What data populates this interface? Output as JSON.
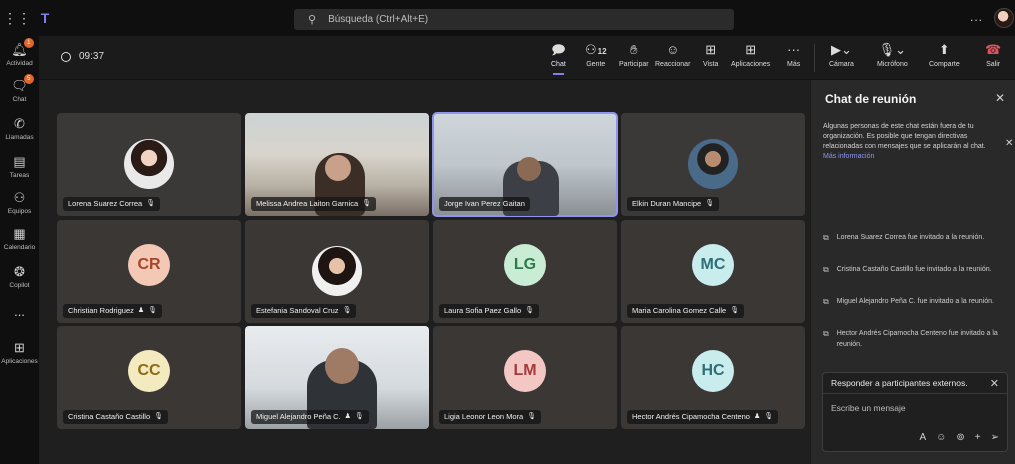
{
  "titlebar": {
    "grid_icon": "apps-grid-icon",
    "search_placeholder": "Búsqueda (Ctrl+Alt+E)",
    "more": "..."
  },
  "rail": {
    "items": [
      {
        "label": "Actividad",
        "badge": "1"
      },
      {
        "label": "Chat",
        "badge": "5"
      },
      {
        "label": "Llamadas"
      },
      {
        "label": "Tareas"
      },
      {
        "label": "Equipos"
      },
      {
        "label": "Calendario"
      },
      {
        "label": "Copilot"
      },
      {
        "label": "..."
      },
      {
        "label": "Aplicaciones"
      }
    ]
  },
  "toolbar": {
    "timer": "09:37",
    "chat": "Chat",
    "people": "Gente",
    "people_count": "12",
    "raise": "Participar",
    "react": "Reaccionar",
    "view": "Vista",
    "apps": "Aplicaciones",
    "more": "Más",
    "camera": "Cámara",
    "mic": "Micrófono",
    "share": "Comparte",
    "leave": "Salir"
  },
  "participants": [
    {
      "name": "Lorena Suarez Correa"
    },
    {
      "name": "Melissa Andrea Laiton Garnica"
    },
    {
      "name": "Jorge Ivan Perez Gaitan"
    },
    {
      "name": "Elkin Duran Mancipe"
    },
    {
      "name": "Christian Rodriguez",
      "initials": "CR",
      "color": "#f3c8b5",
      "text_color": "#a5452a"
    },
    {
      "name": "Estefania Sandoval Cruz"
    },
    {
      "name": "Laura Sofia Paez Gallo",
      "initials": "LG",
      "color": "#c8ecd4",
      "text_color": "#2e7a4b"
    },
    {
      "name": "Maria Carolina Gomez Calle",
      "initials": "MC",
      "color": "#c9ecec",
      "text_color": "#2e6f78"
    },
    {
      "name": "Cristina Castaño Castillo",
      "initials": "CC",
      "color": "#f4eac0",
      "text_color": "#8a6a12"
    },
    {
      "name": "Miguel Alejandro Peña C."
    },
    {
      "name": "Ligia Leonor Leon Mora",
      "initials": "LM",
      "color": "#f3c8c4",
      "text_color": "#a43a3a"
    },
    {
      "name": "Hector Andrés Cipamocha Centeno",
      "initials": "HC",
      "color": "#c9ecec",
      "text_color": "#2e6f78"
    }
  ],
  "chat": {
    "title": "Chat de reunión",
    "notice": "Algunas personas de este chat están fuera de tu organización. Es posible que tengan directivas relacionadas con mensajes que se aplicarán al chat.",
    "notice_link": "Más información",
    "messages": [
      "Lorena Suarez Correa fue invitado a la reunión.",
      "Cristina Castaño Castillo fue invitado a la reunión.",
      "Miguel Alejandro Peña C. fue invitado a la reunión.",
      "Hector Andrés Cipamocha Centeno fue invitado a la reunión."
    ],
    "reply_header": "Responder a participantes externos.",
    "reply_placeholder": "Escribe un mensaje"
  }
}
